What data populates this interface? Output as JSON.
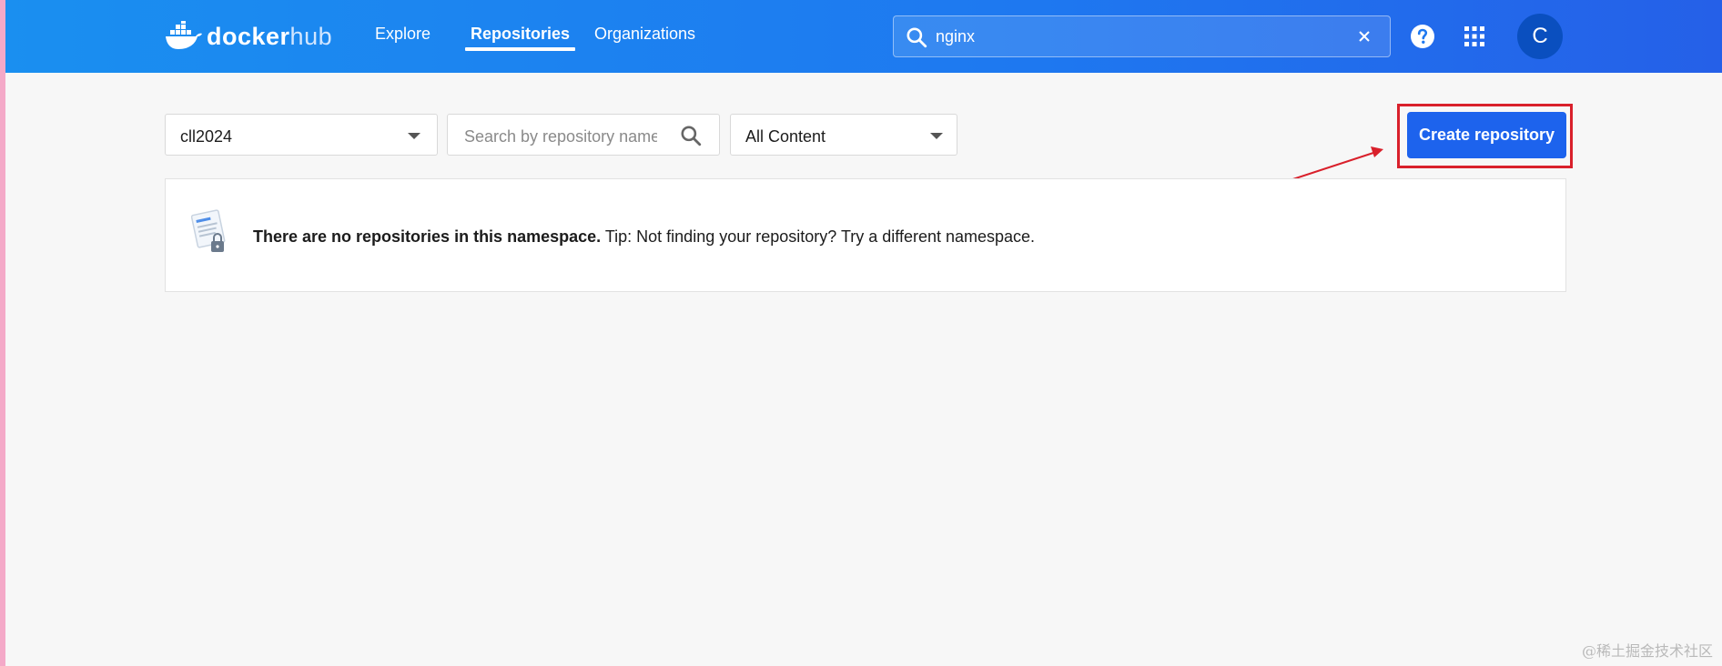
{
  "app": {
    "logo_primary": "docker",
    "logo_secondary": "hub"
  },
  "nav": {
    "items": [
      {
        "label": "Explore",
        "active": false
      },
      {
        "label": "Repositories",
        "active": true
      },
      {
        "label": "Organizations",
        "active": false
      }
    ]
  },
  "global_search": {
    "value": "nginx",
    "icon": "search-icon"
  },
  "header_icons": {
    "help": "help-icon",
    "apps": "apps-grid-icon"
  },
  "user": {
    "avatar_initial": "C"
  },
  "filters": {
    "namespace": "cll2024",
    "repo_search_placeholder": "Search by repository name",
    "content_filter": "All Content"
  },
  "actions": {
    "create_repository": "Create repository"
  },
  "empty_state": {
    "strong_text": "There are no repositories in this namespace.",
    "tip_text": " Tip: Not finding your repository? Try a different namespace."
  },
  "annotation": {
    "highlight_color": "#d9202b"
  },
  "watermark": "@稀土掘金技术社区",
  "colors": {
    "brand_blue": "#1d63ed",
    "header_gradient_start": "#1a8ff0",
    "header_gradient_end": "#2560e8"
  }
}
